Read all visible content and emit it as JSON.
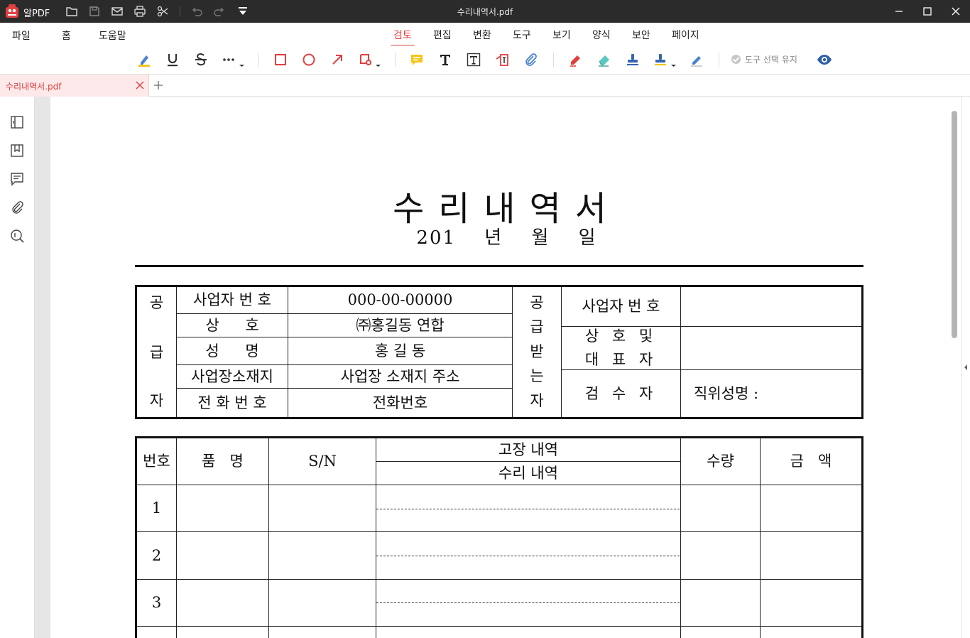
{
  "app": {
    "name": "알PDF",
    "document_title": "수리내역서.pdf",
    "brand_color": "#e04040"
  },
  "menu": {
    "left": [
      "파일",
      "홈",
      "도움말"
    ],
    "tabs": [
      "검토",
      "편집",
      "변환",
      "도구",
      "보기",
      "양식",
      "보안",
      "페이지"
    ],
    "active_tab": "검토"
  },
  "toolbar": {
    "tools": [
      "highlight-icon",
      "underline-icon",
      "strikethrough-icon",
      "more-text-markup-icon",
      "rectangle-icon",
      "ellipse-icon",
      "arrow-icon",
      "shape-dropdown-icon",
      "note-icon",
      "typewriter-icon",
      "textbox-icon",
      "callout-icon",
      "attach-icon",
      "pen-icon",
      "eraser-icon",
      "stamp-icon",
      "stamp-dropdown-icon",
      "signature-icon",
      "eye-icon"
    ],
    "keep_tool_label": "도구 선택 유지"
  },
  "tabs": {
    "open": [
      "수리내역서.pdf"
    ]
  },
  "document": {
    "title": "수리내역서",
    "date_line": "201 년 월 일",
    "supplier": {
      "group_label": [
        "공",
        "급",
        "자"
      ],
      "rows": [
        {
          "label": "사업자 번 호",
          "value": "000-00-00000"
        },
        {
          "label": "상 호",
          "value": "㈜홍길동 연합"
        },
        {
          "label": "성 명",
          "value": "홍 길 동"
        },
        {
          "label": "사업장소재지",
          "value": "사업장 소재지 주소"
        },
        {
          "label": "전 화 번 호",
          "value": "전화번호"
        }
      ]
    },
    "recipient": {
      "group_label": [
        "공",
        "급",
        "받",
        "는",
        "자"
      ],
      "rows": [
        {
          "label": "사업자 번 호",
          "value": ""
        },
        {
          "label": "상 호 및\n대 표 자",
          "value": ""
        },
        {
          "label": "검 수 자",
          "value": "직위성명 :"
        }
      ]
    },
    "items_table": {
      "headers": {
        "no": "번호",
        "name": "품   명",
        "sn": "S/N",
        "fault": "고장 내역",
        "repair": "수리 내역",
        "qty": "수량",
        "amount": "금   액"
      },
      "rows": [
        "1",
        "2",
        "3"
      ]
    }
  }
}
